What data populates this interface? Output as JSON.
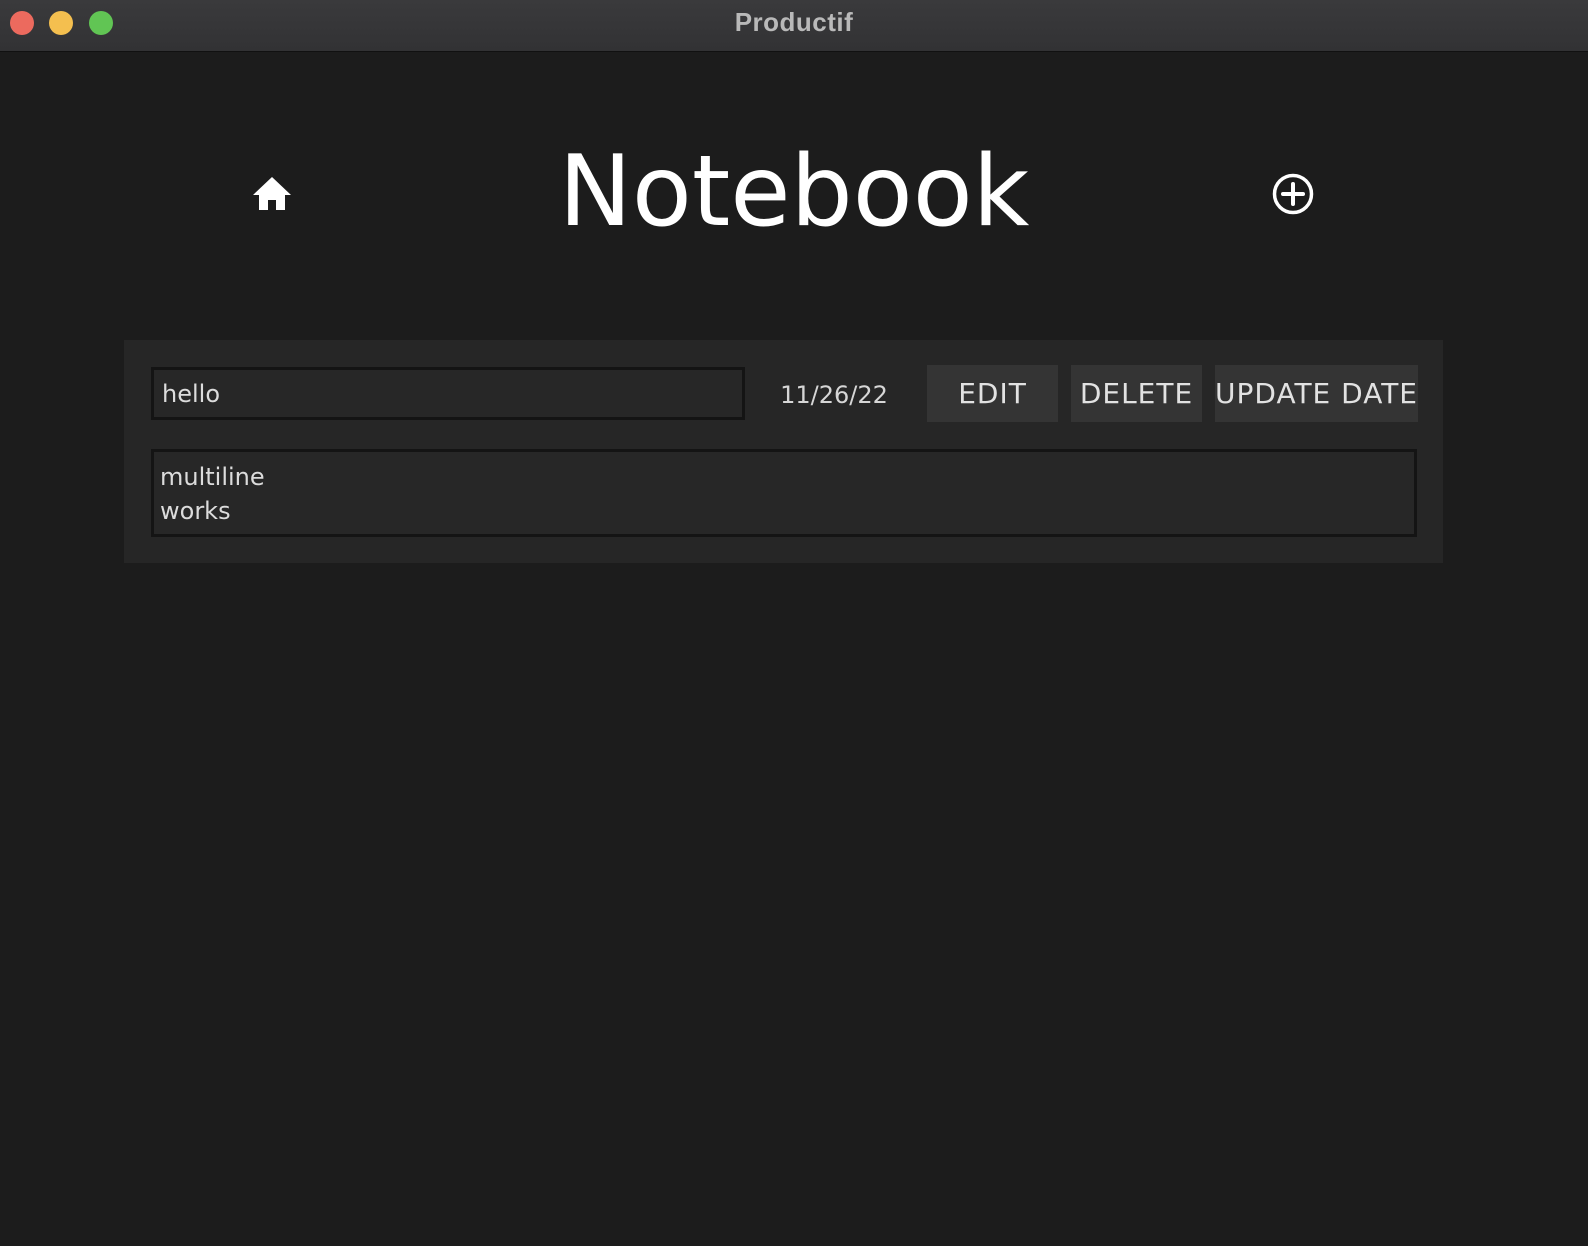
{
  "window": {
    "title": "Productif",
    "controls": {
      "close_color": "#ec6a5e",
      "minimize_color": "#f4bf4f",
      "maximize_color": "#61c554"
    }
  },
  "header": {
    "title": "Notebook",
    "home_icon": "home-icon",
    "add_icon": "plus-circle-icon"
  },
  "notes": [
    {
      "title_value": "hello",
      "date": "11/26/22",
      "edit_label": "EDIT",
      "delete_label": "DELETE",
      "update_date_label": "UPDATE DATE",
      "body": "multiline\nworks"
    }
  ],
  "colors": {
    "background": "#1c1c1c",
    "card": "#262626",
    "button": "#343434",
    "text": "#ffffff"
  }
}
